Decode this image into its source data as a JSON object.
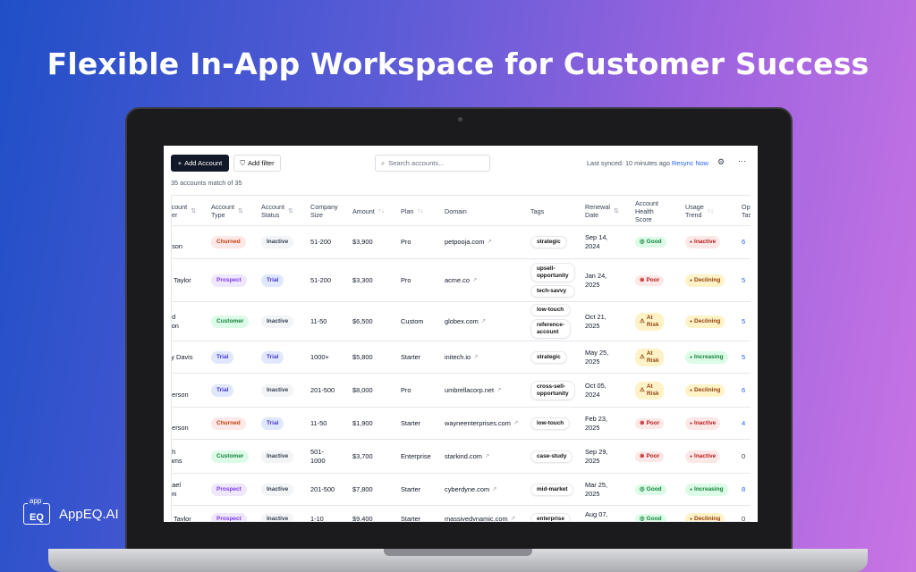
{
  "headline": "Flexible In-App Workspace for Customer Success",
  "brand": {
    "logo_top": "app",
    "logo_mark": "EQ",
    "name": "AppEQ.AI"
  },
  "toolbar": {
    "add_account": "Add Account",
    "add_filter": "Add filter",
    "search_placeholder": "Search accounts...",
    "last_synced": "Last synced: 10 minutes ago",
    "resync": "Resync Now"
  },
  "count_text": "35 accounts match of 35",
  "columns": [
    {
      "label": "ccount\nner",
      "sort": "⇅"
    },
    {
      "label": "Account\nType",
      "sort": "⇅"
    },
    {
      "label": "Account\nStatus",
      "sort": "⇅"
    },
    {
      "label": "Company\nSize",
      "sort": ""
    },
    {
      "label": "Amount",
      "sort": "↑↓"
    },
    {
      "label": "Plan",
      "sort": "↑↓"
    },
    {
      "label": "Domain",
      "sort": ""
    },
    {
      "label": "Tags",
      "sort": ""
    },
    {
      "label": "Renewal\nDate",
      "sort": "⇅"
    },
    {
      "label": "Account\nHealth\nScore",
      "sort": ""
    },
    {
      "label": "Usage\nTrend",
      "sort": "↑↓"
    },
    {
      "label": "Ope\nTas",
      "sort": ""
    }
  ],
  "rows": [
    {
      "owner": "k\nnson",
      "type": "Churned",
      "type_cls": "churned",
      "status": "Inactive",
      "status_cls": "inactive",
      "size": "51-200",
      "amount": "$3,900",
      "plan": "Pro",
      "domain": "petpooja.com",
      "tags": [
        "strategic"
      ],
      "renewal": "Sep 14,\n2024",
      "health": "Good",
      "health_cls": "good",
      "trend": "Inactive",
      "trend_cls": "inactive",
      "open": "6"
    },
    {
      "owner": "n Taylor",
      "type": "Prospect",
      "type_cls": "prospect",
      "status": "Trial",
      "status_cls": "trial",
      "size": "51-200",
      "amount": "$3,300",
      "plan": "Pro",
      "domain": "acme.co",
      "tags": [
        "upsell-\nopportunity",
        "tech-savvy"
      ],
      "renewal": "Jan 24,\n2025",
      "health": "Poor",
      "health_cls": "poor",
      "trend": "Declining",
      "trend_cls": "declining",
      "open": "5"
    },
    {
      "owner": "rid\nson",
      "type": "Customer",
      "type_cls": "customer",
      "status": "Inactive",
      "status_cls": "inactive",
      "size": "11-50",
      "amount": "$6,500",
      "plan": "Custom",
      "domain": "globex.com",
      "tags": [
        "low-touch",
        "reference-\naccount"
      ],
      "renewal": "Oct 21,\n2025",
      "health": "At\nRisk",
      "health_cls": "risk",
      "trend": "Declining",
      "trend_cls": "declining",
      "open": "5"
    },
    {
      "owner": "ily Davis",
      "type": "Trial",
      "type_cls": "trial",
      "status": "Trial",
      "status_cls": "trial",
      "size": "1000+",
      "amount": "$5,800",
      "plan": "Starter",
      "domain": "initech.io",
      "tags": [
        "strategic"
      ],
      "renewal": "May 25,\n2025",
      "health": "At\nRisk",
      "health_cls": "risk",
      "trend": "Increasing",
      "trend_cls": "increasing",
      "open": "5"
    },
    {
      "owner": "k\nderson",
      "type": "Trial",
      "type_cls": "trial",
      "status": "Inactive",
      "status_cls": "inactive",
      "size": "201-500",
      "amount": "$8,000",
      "plan": "Pro",
      "domain": "umbrellacorp.net",
      "tags": [
        "cross-sell-\nopportunity"
      ],
      "renewal": "Oct 05,\n2024",
      "health": "At\nRisk",
      "health_cls": "risk",
      "trend": "Declining",
      "trend_cls": "declining",
      "open": "6"
    },
    {
      "owner": "a\nderson",
      "type": "Churned",
      "type_cls": "churned",
      "status": "Trial",
      "status_cls": "trial",
      "size": "11-50",
      "amount": "$1,900",
      "plan": "Starter",
      "domain": "wayneenterprises.com",
      "tags": [
        "low-touch"
      ],
      "renewal": "Feb 23,\n2025",
      "health": "Poor",
      "health_cls": "poor",
      "trend": "Inactive",
      "trend_cls": "inactive",
      "open": "4"
    },
    {
      "owner": "ah\niams",
      "type": "Customer",
      "type_cls": "customer",
      "status": "Inactive",
      "status_cls": "inactive",
      "size": "501-\n1000",
      "amount": "$3,700",
      "plan": "Enterprise",
      "domain": "starkind.com",
      "tags": [
        "case-study"
      ],
      "renewal": "Sep 29,\n2025",
      "health": "Poor",
      "health_cls": "poor",
      "trend": "Inactive",
      "trend_cls": "inactive",
      "open": "0"
    },
    {
      "owner": "hael\nwn",
      "type": "Prospect",
      "type_cls": "prospect",
      "status": "Inactive",
      "status_cls": "inactive",
      "size": "201-500",
      "amount": "$7,800",
      "plan": "Starter",
      "domain": "cyberdyne.com",
      "tags": [
        "mid-market"
      ],
      "renewal": "Mar 25,\n2025",
      "health": "Good",
      "health_cls": "good",
      "trend": "Increasing",
      "trend_cls": "increasing",
      "open": "8"
    },
    {
      "owner": "n Taylor",
      "type": "Prospect",
      "type_cls": "prospect",
      "status": "Inactive",
      "status_cls": "inactive",
      "size": "1-10",
      "amount": "$9,400",
      "plan": "Starter",
      "domain": "massivedynamic.com",
      "tags": [
        "enterprise"
      ],
      "renewal": "Aug 07,\n2025",
      "health": "Good",
      "health_cls": "good",
      "trend": "Declining",
      "trend_cls": "declining",
      "open": "0"
    }
  ],
  "health_icons": {
    "good": "◎",
    "poor": "⊗",
    "risk": "⚠"
  },
  "trend_icon": "●"
}
